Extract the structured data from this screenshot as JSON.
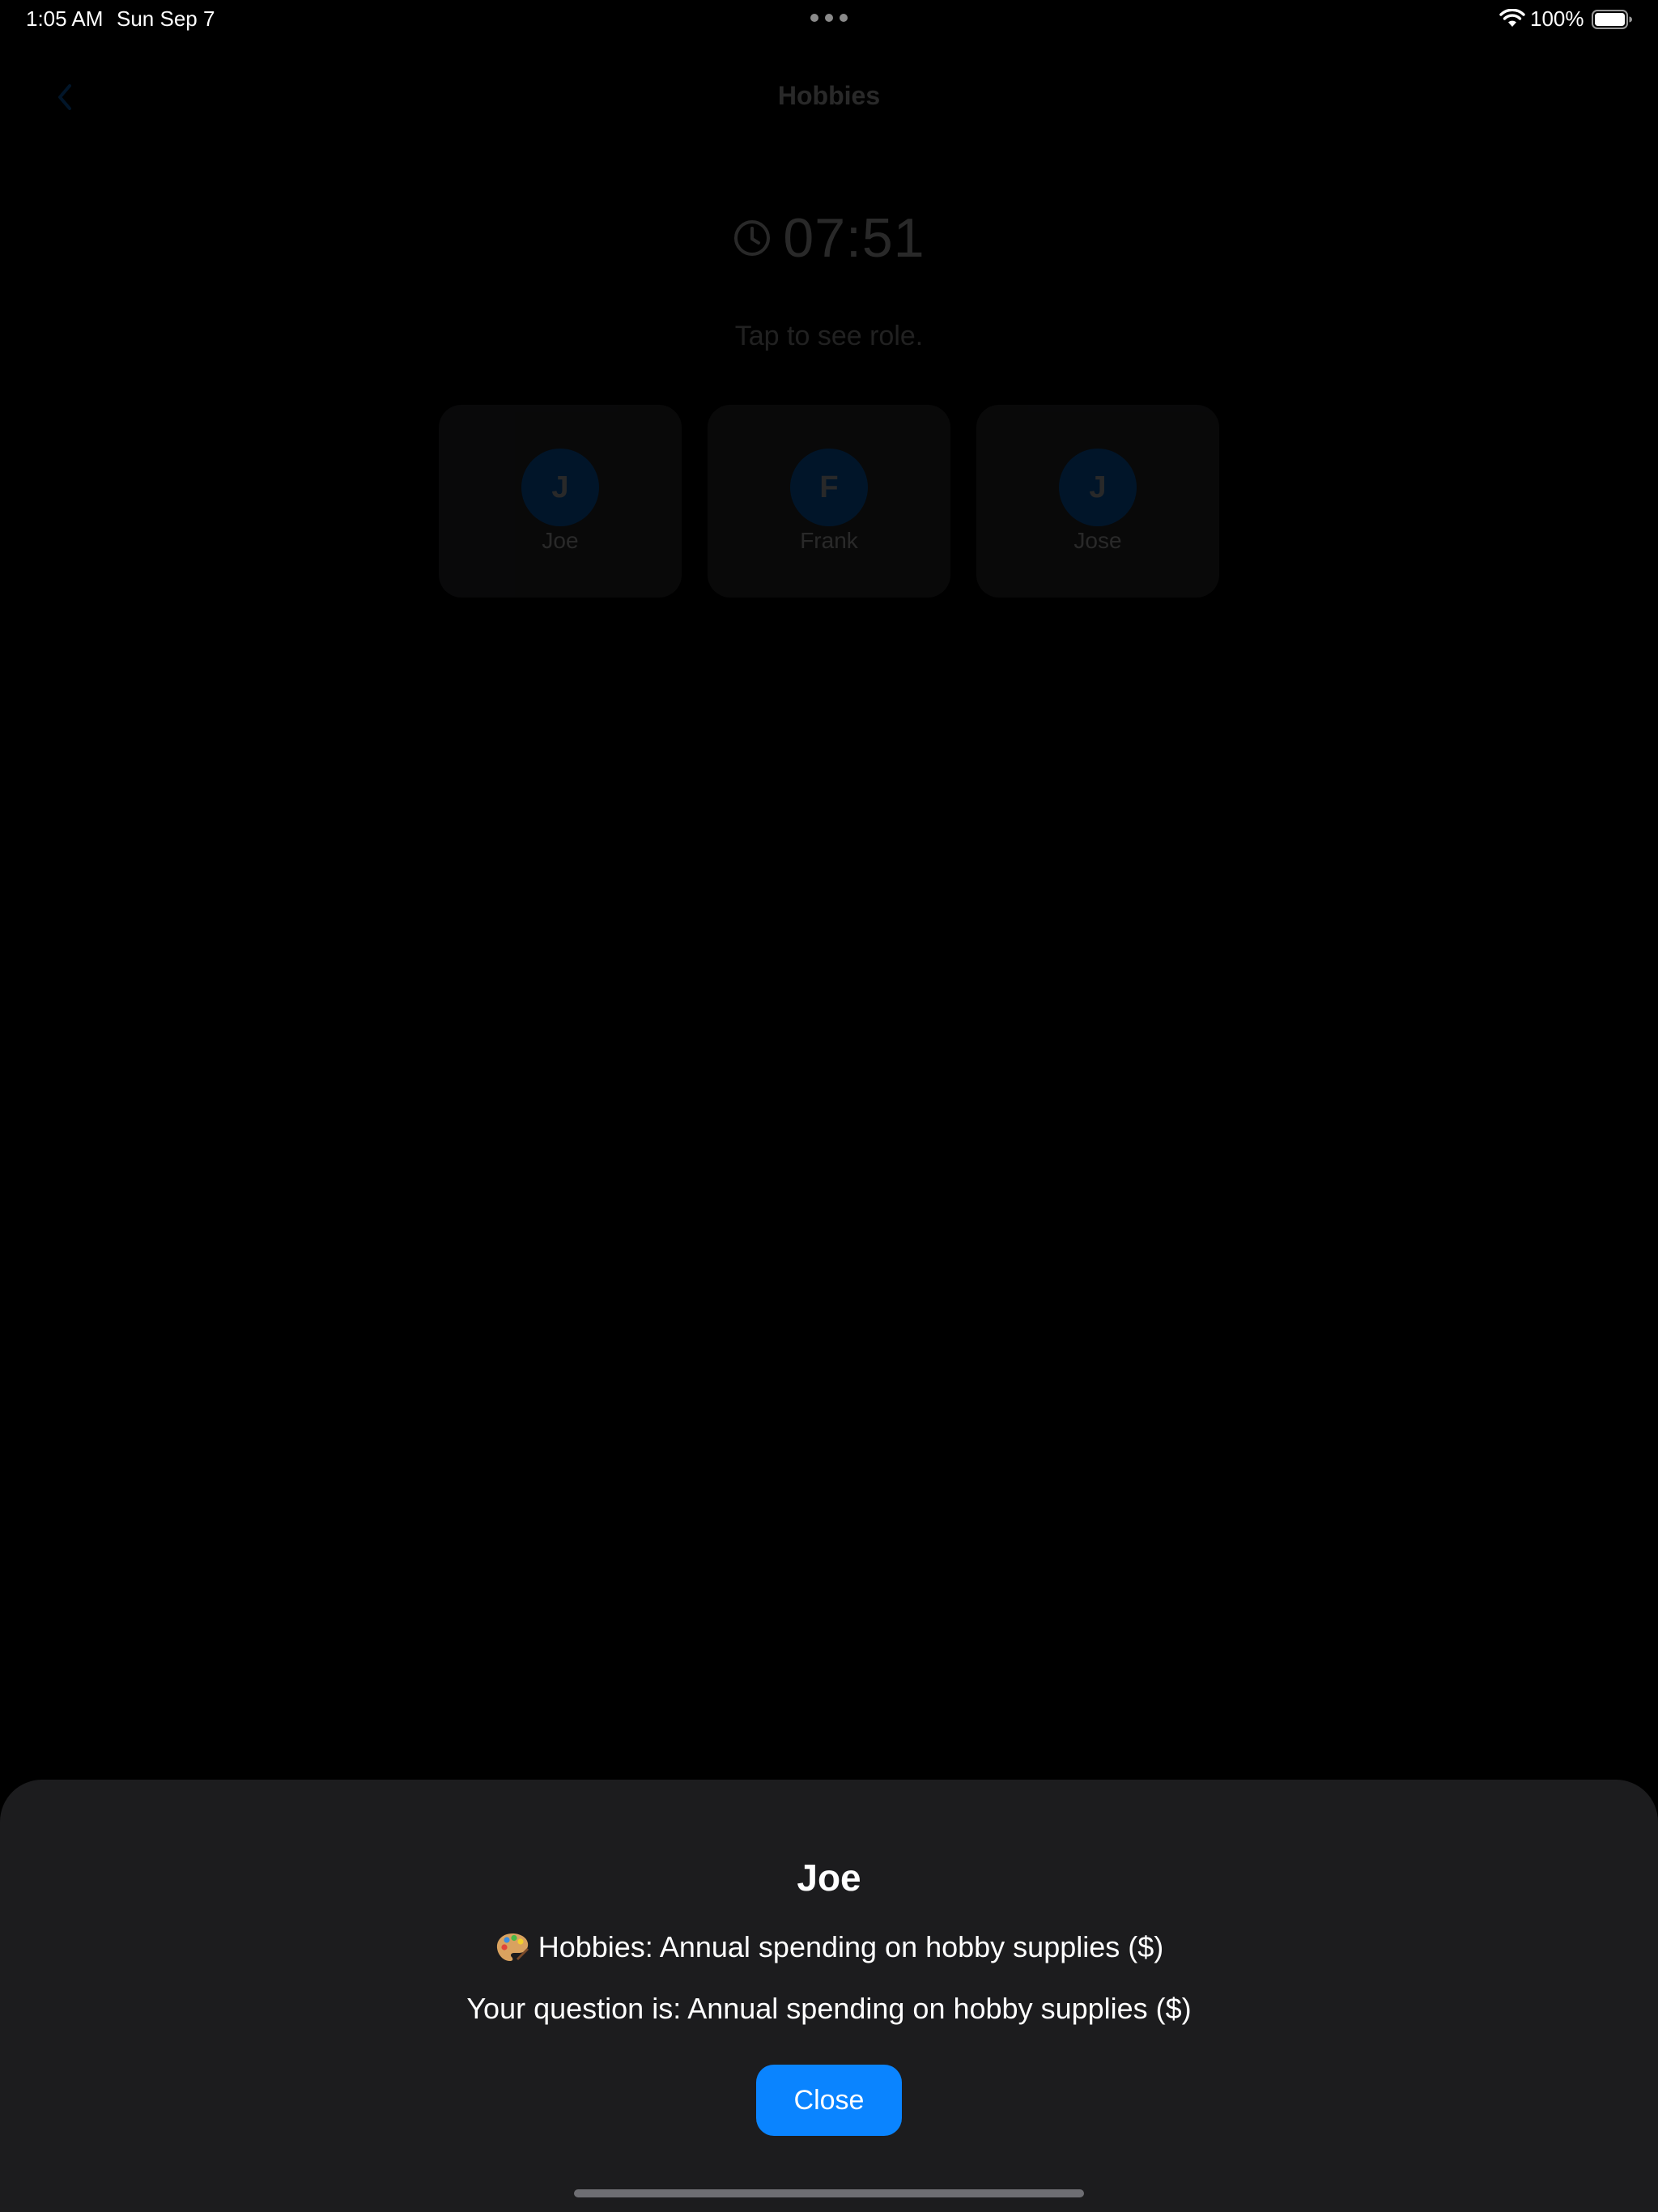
{
  "status_bar": {
    "time": "1:05 AM",
    "date": "Sun Sep 7",
    "battery_percent": "100%",
    "icons": [
      "multitasking-dots-icon",
      "wifi-icon",
      "battery-icon"
    ]
  },
  "nav": {
    "title": "Hobbies",
    "back_icon": "chevron-left-icon"
  },
  "timer": {
    "icon": "clock-icon",
    "value": "07:51"
  },
  "hint": "Tap to see role.",
  "players": [
    {
      "initial": "J",
      "name": "Joe"
    },
    {
      "initial": "F",
      "name": "Frank"
    },
    {
      "initial": "J",
      "name": "Jose"
    }
  ],
  "sheet": {
    "title": "Joe",
    "category_icon": "palette-icon",
    "category": "Hobbies: Annual spending on hobby supplies ($)",
    "question": "Your question is: Annual spending on hobby supplies ($)",
    "close_label": "Close"
  },
  "colors": {
    "accent": "#0a84ff",
    "sheet_background": "#1c1c1e",
    "card_background": "#3a3a3c"
  }
}
